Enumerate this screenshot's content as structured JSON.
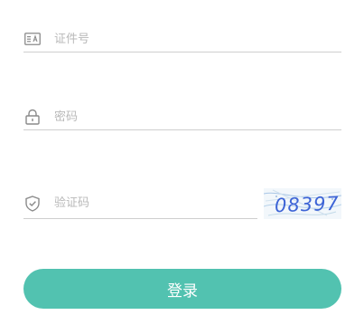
{
  "form": {
    "id_field": {
      "placeholder": "证件号",
      "value": "",
      "icon": "id-card-icon"
    },
    "password_field": {
      "placeholder": "密码",
      "value": "",
      "icon": "lock-icon"
    },
    "captcha_field": {
      "placeholder": "验证码",
      "value": "",
      "icon": "shield-check-icon"
    },
    "captcha_image": {
      "text": "08397"
    },
    "login_button": {
      "label": "登录"
    }
  },
  "colors": {
    "accent": "#52c2b0",
    "field_border": "#cfcfcf",
    "placeholder": "#b9b9b9",
    "icon": "#8a8a8a",
    "captcha_text": "#3d64d6"
  }
}
